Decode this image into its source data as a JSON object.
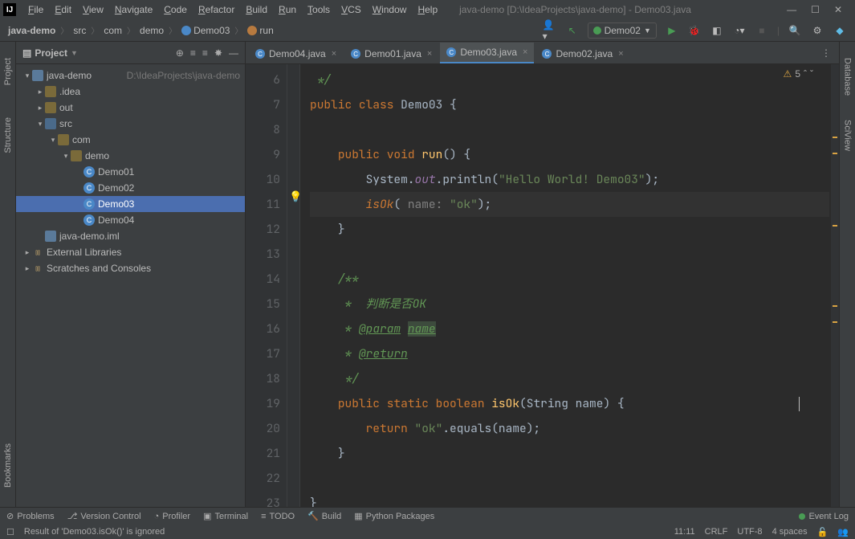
{
  "menubar": {
    "items": [
      "File",
      "Edit",
      "View",
      "Navigate",
      "Code",
      "Refactor",
      "Build",
      "Run",
      "Tools",
      "VCS",
      "Window",
      "Help"
    ],
    "title": "java-demo [D:\\IdeaProjects\\java-demo] - Demo03.java"
  },
  "navbar": {
    "crumbs": [
      {
        "label": "java-demo",
        "bold": true
      },
      {
        "label": "src"
      },
      {
        "label": "com"
      },
      {
        "label": "demo"
      },
      {
        "label": "Demo03",
        "icon": "class"
      },
      {
        "label": "run",
        "icon": "method"
      }
    ],
    "run_config": "Demo02"
  },
  "project_panel": {
    "title": "Project",
    "tree": [
      {
        "d": 0,
        "arrow": "v",
        "icon": "module",
        "label": "java-demo",
        "path": "D:\\IdeaProjects\\java-demo"
      },
      {
        "d": 1,
        "arrow": ">",
        "icon": "folder",
        "label": ".idea"
      },
      {
        "d": 1,
        "arrow": ">",
        "icon": "folder",
        "label": "out"
      },
      {
        "d": 1,
        "arrow": "v",
        "icon": "folder-blue",
        "label": "src"
      },
      {
        "d": 2,
        "arrow": "v",
        "icon": "folder",
        "label": "com"
      },
      {
        "d": 3,
        "arrow": "v",
        "icon": "folder",
        "label": "demo"
      },
      {
        "d": 4,
        "arrow": "",
        "icon": "class",
        "label": "Demo01"
      },
      {
        "d": 4,
        "arrow": "",
        "icon": "class",
        "label": "Demo02"
      },
      {
        "d": 4,
        "arrow": "",
        "icon": "class",
        "label": "Demo03",
        "selected": true
      },
      {
        "d": 4,
        "arrow": "",
        "icon": "class",
        "label": "Demo04"
      },
      {
        "d": 1,
        "arrow": "",
        "icon": "module",
        "label": "java-demo.iml"
      },
      {
        "d": 0,
        "arrow": ">",
        "icon": "lib",
        "label": "External Libraries"
      },
      {
        "d": 0,
        "arrow": ">",
        "icon": "lib",
        "label": "Scratches and Consoles"
      }
    ]
  },
  "left_tools": [
    "Project",
    "Structure",
    "Bookmarks"
  ],
  "right_tools": [
    "Database",
    "SciView"
  ],
  "tabs": {
    "items": [
      {
        "label": "Demo04.java"
      },
      {
        "label": "Demo01.java"
      },
      {
        "label": "Demo03.java",
        "active": true
      },
      {
        "label": "Demo02.java"
      }
    ]
  },
  "badge": {
    "warnings": "5"
  },
  "gutter": [
    "6",
    "7",
    "8",
    "9",
    "10",
    "11",
    "12",
    "13",
    "14",
    "15",
    "16",
    "17",
    "18",
    "19",
    "20",
    "21",
    "22",
    "23"
  ],
  "code": {
    "6": {
      "indent": " ",
      "tokens": [
        {
          "t": "*/",
          "cls": "doc"
        }
      ]
    },
    "7": {
      "indent": "",
      "tokens": [
        {
          "t": "public ",
          "cls": "kw"
        },
        {
          "t": "class ",
          "cls": "kw"
        },
        {
          "t": "Demo03 ",
          "cls": "cls"
        },
        {
          "t": "{",
          "cls": ""
        }
      ]
    },
    "8": {
      "indent": "",
      "tokens": []
    },
    "9": {
      "indent": "    ",
      "tokens": [
        {
          "t": "public ",
          "cls": "kw"
        },
        {
          "t": "void ",
          "cls": "kw"
        },
        {
          "t": "run",
          "cls": "fn"
        },
        {
          "t": "() {",
          "cls": ""
        }
      ]
    },
    "10": {
      "indent": "        ",
      "tokens": [
        {
          "t": "System.",
          "cls": ""
        },
        {
          "t": "out",
          "cls": "field"
        },
        {
          "t": ".println(",
          "cls": ""
        },
        {
          "t": "\"Hello World! Demo03\"",
          "cls": "str"
        },
        {
          "t": ");",
          "cls": ""
        }
      ]
    },
    "11": {
      "indent": "        ",
      "tokens": [
        {
          "t": "isOk",
          "cls": "st"
        },
        {
          "t": "( ",
          "cls": ""
        },
        {
          "t": "name: ",
          "cls": "param"
        },
        {
          "t": "\"ok\"",
          "cls": "str"
        },
        {
          "t": ");",
          "cls": ""
        }
      ],
      "hl": true
    },
    "12": {
      "indent": "    ",
      "tokens": [
        {
          "t": "}",
          "cls": ""
        }
      ]
    },
    "13": {
      "indent": "",
      "tokens": []
    },
    "14": {
      "indent": "    ",
      "tokens": [
        {
          "t": "/**",
          "cls": "doc"
        }
      ]
    },
    "15": {
      "indent": "    ",
      "tokens": [
        {
          "t": " *  判断是否OK",
          "cls": "doc"
        }
      ]
    },
    "16": {
      "indent": "    ",
      "tokens": [
        {
          "t": " * ",
          "cls": "doc"
        },
        {
          "t": "@param",
          "cls": "doctag"
        },
        {
          "t": " ",
          "cls": "doc"
        },
        {
          "t": "name",
          "cls": "doctag bg"
        }
      ]
    },
    "17": {
      "indent": "    ",
      "tokens": [
        {
          "t": " * ",
          "cls": "doc"
        },
        {
          "t": "@return",
          "cls": "doctag"
        }
      ]
    },
    "18": {
      "indent": "    ",
      "tokens": [
        {
          "t": " */",
          "cls": "doc"
        }
      ]
    },
    "19": {
      "indent": "    ",
      "tokens": [
        {
          "t": "public ",
          "cls": "kw"
        },
        {
          "t": "static ",
          "cls": "kw"
        },
        {
          "t": "boolean ",
          "cls": "kw"
        },
        {
          "t": "isOk",
          "cls": "fn"
        },
        {
          "t": "(String name) {",
          "cls": ""
        }
      ],
      "caret": true
    },
    "20": {
      "indent": "        ",
      "tokens": [
        {
          "t": "return ",
          "cls": "kw"
        },
        {
          "t": "\"ok\"",
          "cls": "str"
        },
        {
          "t": ".equals(name);",
          "cls": ""
        }
      ]
    },
    "21": {
      "indent": "    ",
      "tokens": [
        {
          "t": "}",
          "cls": ""
        }
      ]
    },
    "22": {
      "indent": "",
      "tokens": []
    },
    "23": {
      "indent": "",
      "tokens": [
        {
          "t": "}",
          "cls": ""
        }
      ]
    }
  },
  "bottombar": {
    "items": [
      "Problems",
      "Version Control",
      "Profiler",
      "Terminal",
      "TODO",
      "Build",
      "Python Packages"
    ],
    "event_log": "Event Log"
  },
  "status": {
    "message": "Result of 'Demo03.isOk()' is ignored",
    "pos": "11:11",
    "eol": "CRLF",
    "enc": "UTF-8",
    "indent": "4 spaces"
  }
}
